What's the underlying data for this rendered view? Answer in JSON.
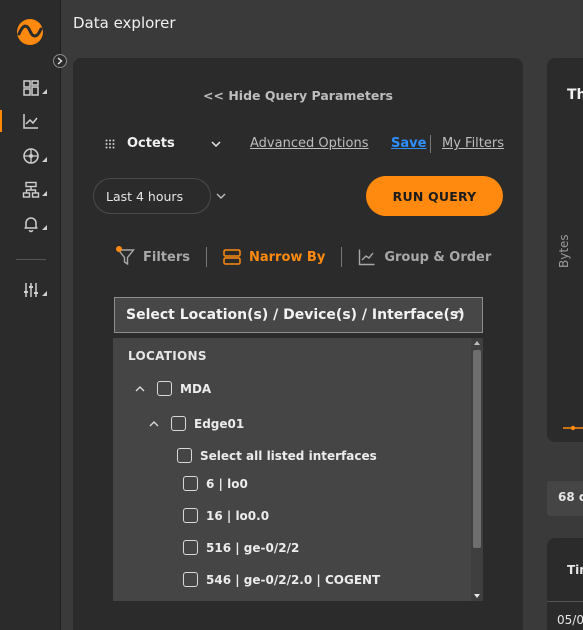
{
  "app": {
    "title": "Data explorer"
  },
  "colors": {
    "accent": "#ff8a0f",
    "link": "#2f8fff",
    "panel": "#2b2b2b",
    "background": "#3a3a3a"
  },
  "sidebar": {
    "items": [
      {
        "name": "dashboards",
        "icon": "dashboard-grid-icon",
        "has_submenu": true
      },
      {
        "name": "data-explorer",
        "icon": "line-chart-icon",
        "active": true,
        "has_submenu": false
      },
      {
        "name": "network",
        "icon": "network-globe-icon",
        "has_submenu": true
      },
      {
        "name": "inventory",
        "icon": "hierarchy-icon",
        "has_submenu": true
      },
      {
        "name": "alerts",
        "icon": "bell-icon",
        "has_submenu": true
      },
      {
        "name": "settings",
        "icon": "sliders-icon",
        "has_submenu": true
      }
    ]
  },
  "query": {
    "hide_params_label": "Hide Query Parameters",
    "metric": "Octets",
    "advanced_options": "Advanced Options",
    "save": "Save",
    "my_filters": "My Filters",
    "time_range": "Last 4 hours",
    "run_query": "RUN QUERY",
    "tabs": [
      {
        "label": "Filters",
        "icon": "filter-icon",
        "active": false
      },
      {
        "label": "Narrow By",
        "icon": "narrow-by-icon",
        "active": true
      },
      {
        "label": "Group & Order",
        "icon": "chart-order-icon",
        "active": false
      }
    ],
    "location_select": "Select Location(s) / Device(s) / Interface(s)",
    "tree": {
      "heading": "LOCATIONS",
      "location": "MDA",
      "device": "Edge01",
      "select_all": "Select all listed interfaces",
      "interfaces": [
        "6 | lo0",
        "16 | lo0.0",
        "516 | ge-0/2/2",
        "546 | ge-0/2/2.0 | COGENT"
      ]
    }
  },
  "chart": {
    "title_partial": "Th",
    "y_axis_label": "Bytes"
  },
  "results": {
    "count_partial": "68 o",
    "table_header_partial": "Tin",
    "first_cell_partial": "05/0"
  }
}
